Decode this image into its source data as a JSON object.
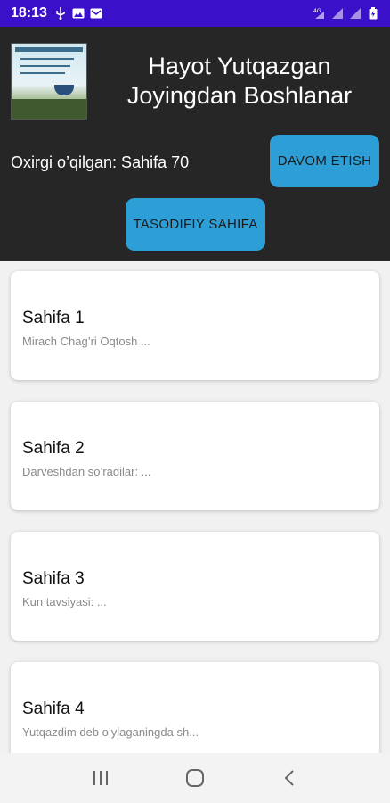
{
  "status_bar": {
    "time": "18:13",
    "left_icons": [
      "usb-icon",
      "image-icon",
      "mail-icon"
    ],
    "right_icons": [
      "4g-signal-icon",
      "signal-icon",
      "signal-icon-2",
      "battery-icon"
    ]
  },
  "header": {
    "title": "Hayot Yutqazgan Joyingdan Boshlanar",
    "last_read": "Oxirgi o’qilgan: Sahifa 70",
    "continue_button": "DAVOM ETISH",
    "random_button": "TASODIFIY SAHIFA",
    "cover_text": "Hayot yutqazgan joyingdan boshlanar"
  },
  "pages": [
    {
      "title": "Sahifa 1",
      "subtitle": "Mirach Chag’ri Oqtosh ..."
    },
    {
      "title": "Sahifa 2",
      "subtitle": "Darveshdan so’radilar: ..."
    },
    {
      "title": "Sahifa 3",
      "subtitle": "Kun tavsiyasi: ..."
    },
    {
      "title": "Sahifa 4",
      "subtitle": "Yutqazdim deb o’ylaganingda sh..."
    }
  ],
  "nav": {
    "icons": [
      "recent-apps-icon",
      "home-icon",
      "back-icon"
    ]
  },
  "colors": {
    "status_bar": "#3a10c8",
    "header_bg": "#262626",
    "button_bg": "#2d9fd6",
    "list_bg": "#f1f1f1"
  }
}
